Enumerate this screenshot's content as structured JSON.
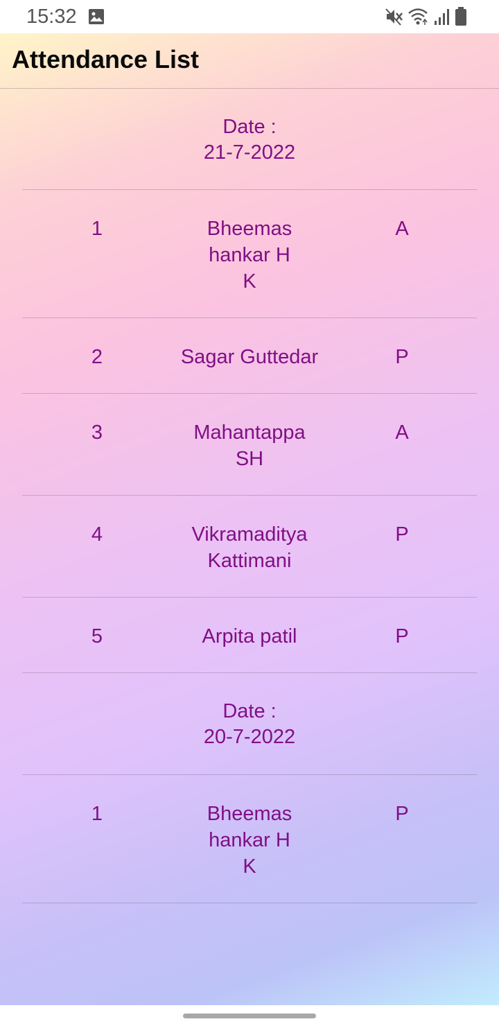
{
  "status_bar": {
    "time": "15:32",
    "icons": [
      "gallery-icon",
      "mute-icon",
      "wifi-icon",
      "signal-icon",
      "battery-icon"
    ]
  },
  "app_bar": {
    "title": "Attendance List"
  },
  "groups": [
    {
      "date_label": "Date :",
      "date_value": "21-7-2022",
      "records": [
        {
          "num": "1",
          "name_lines": [
            "Bheemas",
            "hankar H",
            "K"
          ],
          "status": "A"
        },
        {
          "num": "2",
          "name_lines": [
            "Sagar Guttedar"
          ],
          "status": "P"
        },
        {
          "num": "3",
          "name_lines": [
            "Mahantappa",
            "SH"
          ],
          "status": "A"
        },
        {
          "num": "4",
          "name_lines": [
            "Vikramaditya",
            "Kattimani"
          ],
          "status": "P"
        },
        {
          "num": "5",
          "name_lines": [
            "Arpita patil"
          ],
          "status": "P"
        }
      ]
    },
    {
      "date_label": "Date :",
      "date_value": "20-7-2022",
      "records": [
        {
          "num": "1",
          "name_lines": [
            "Bheemas",
            "hankar H",
            "K"
          ],
          "status": "P"
        }
      ]
    }
  ],
  "colors": {
    "text_accent": "#800f85",
    "title": "#0a0a0a"
  }
}
